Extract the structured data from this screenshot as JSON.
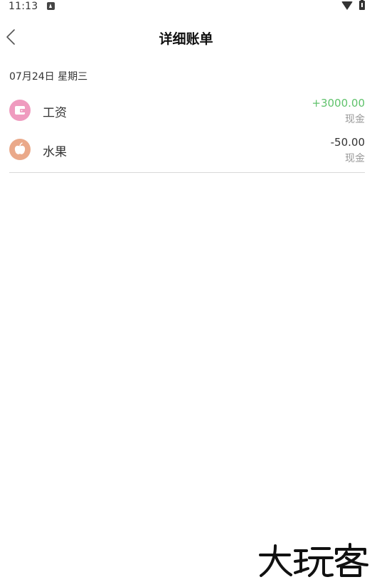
{
  "status_bar": {
    "time": "11:13",
    "notification_icon": "a-notification-icon",
    "wifi_icon": "wifi-icon",
    "battery_icon": "battery-charging-icon"
  },
  "header": {
    "back_icon": "chevron-left-icon",
    "title": "详细账单"
  },
  "date_label": "07月24日 星期三",
  "bills": [
    {
      "icon": "wallet-icon",
      "icon_color": "#ef9bbf",
      "category": "工资",
      "amount": "+3000.00",
      "amount_color": "#5fc26b",
      "account": "现金"
    },
    {
      "icon": "apple-icon",
      "icon_color": "#eaa98a",
      "category": "水果",
      "amount": "-50.00",
      "amount_color": "#333333",
      "account": "现金"
    }
  ],
  "watermark": {
    "text": "大玩客"
  }
}
